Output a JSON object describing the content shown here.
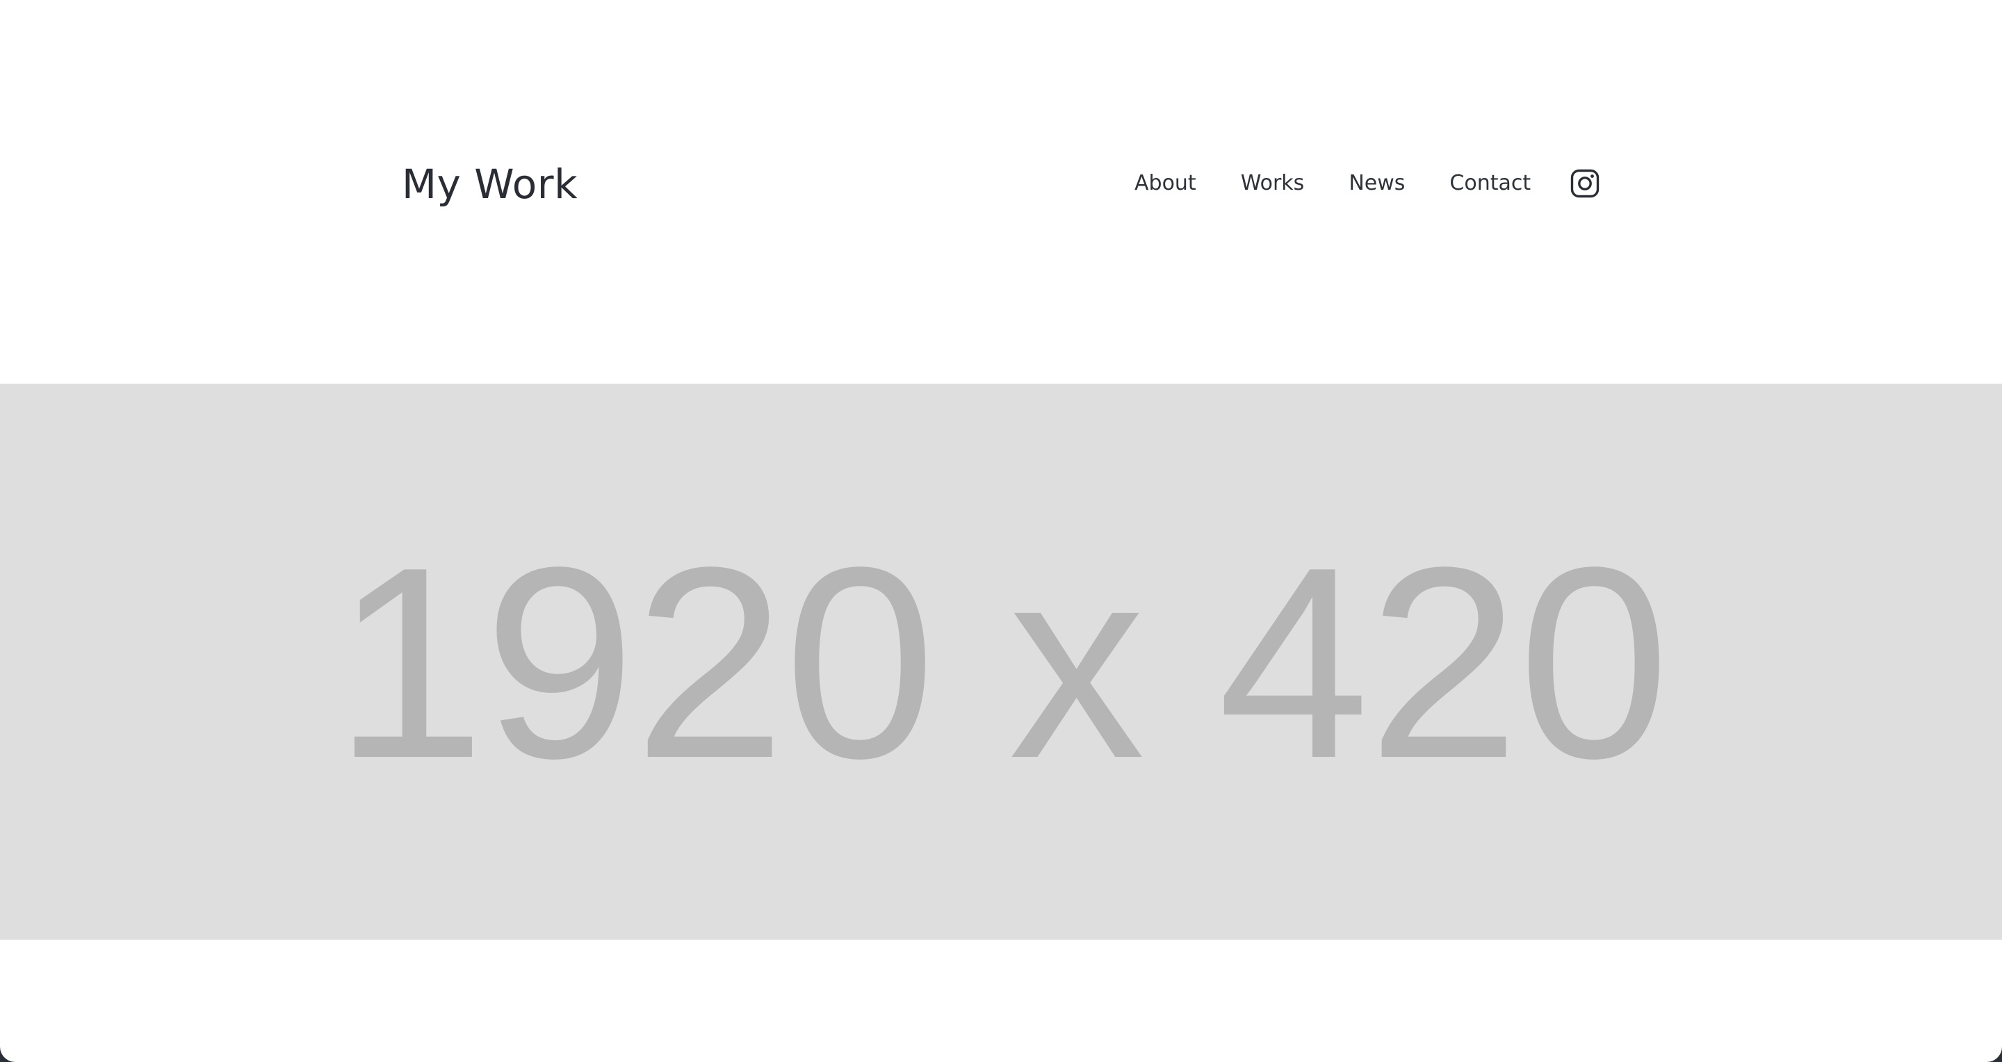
{
  "header": {
    "site_title": "My Work",
    "nav": [
      {
        "label": "About"
      },
      {
        "label": "Works"
      },
      {
        "label": "News"
      },
      {
        "label": "Contact"
      }
    ],
    "social_icon": "instagram-icon"
  },
  "hero": {
    "placeholder_text": "1920 x 420"
  },
  "colors": {
    "text": "#2a2d33",
    "hero_bg": "#dedede",
    "hero_text": "#b5b5b5",
    "page_bg": "#ffffff",
    "frame": "#2b2f36"
  }
}
